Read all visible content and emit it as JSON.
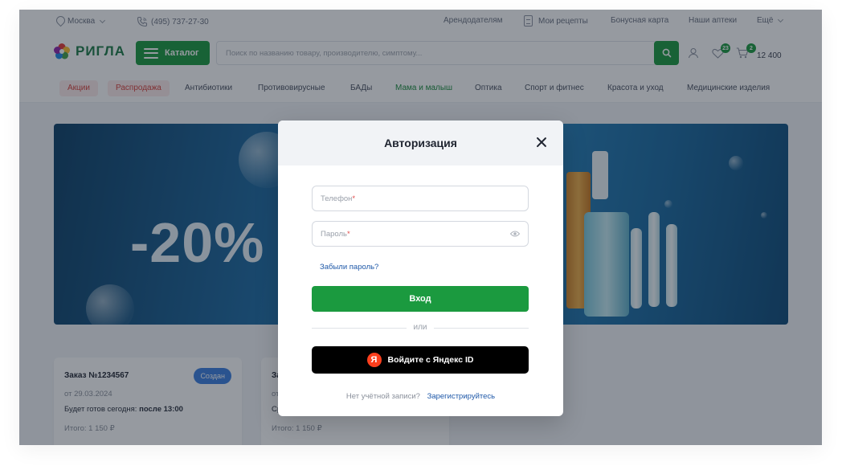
{
  "topbar": {
    "city": "Москва",
    "phone": "(495) 737-27-30",
    "links": [
      "Арендодателям",
      "Мои рецепты",
      "Бонусная карта",
      "Наши аптеки",
      "Ещё"
    ]
  },
  "header": {
    "logo_text": "РИГЛА",
    "catalog_label": "Каталог",
    "search_placeholder": "Поиск по названию товару, производителю, симптому...",
    "favorites_count": "23",
    "cart_count": "2",
    "cart_sum": "12 400"
  },
  "nav": {
    "items": [
      "Акции",
      "Распродажа",
      "Антибиотики",
      "Противовирусные",
      "БАДы",
      "Мама и малыш",
      "Оптика",
      "Спорт и фитнес",
      "Красота и уход",
      "Медицинские изделия"
    ]
  },
  "banner": {
    "text": "-20%"
  },
  "orders": [
    {
      "title": "Заказ №1234567",
      "status": "Создан",
      "date": "от 29.03.2024",
      "ready_prefix": "Будет готов сегодня: ",
      "ready_time": "после 13:00",
      "total": "Итого: 1 150 ₽"
    },
    {
      "title": "За",
      "date": "от",
      "ready_prefix": "Ср",
      "total": "Итого: 1 150 ₽"
    }
  ],
  "modal": {
    "title": "Авторизация",
    "phone_placeholder": "Телефон",
    "password_placeholder": "Пароль",
    "required_mark": "*",
    "forgot": "Забыли пароль?",
    "login_label": "Вход",
    "or": "или",
    "yandex_label": "Войдите с Яндекс ID",
    "yandex_letter": "Я",
    "no_account": "Нет учётной записи?",
    "register": "Зарегистрируйтесь"
  },
  "colors": {
    "brand_green": "#1b9a3f",
    "link_blue": "#1e58a8",
    "status_blue": "#3b7fe0",
    "promo_red": "#d8413c"
  },
  "icons": [
    "location-pin-icon",
    "phone-icon",
    "prescription-icon",
    "search-icon",
    "user-icon",
    "heart-icon",
    "cart-icon",
    "close-icon",
    "eye-icon",
    "yandex-icon"
  ]
}
